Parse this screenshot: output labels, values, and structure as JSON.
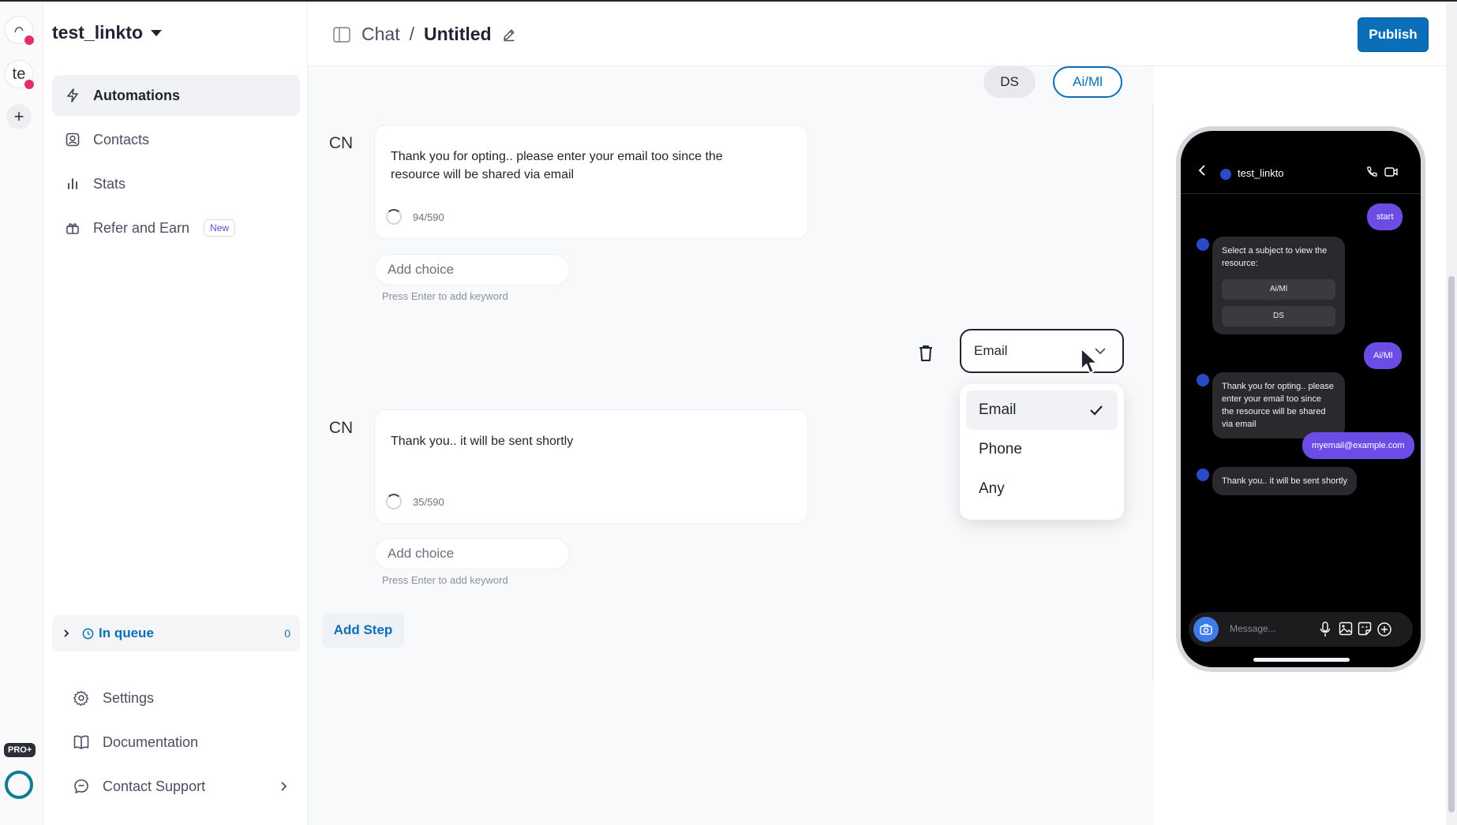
{
  "workspace": {
    "name": "test_linkto"
  },
  "rail": {
    "account2_initials": "te",
    "pro_label": "PRO+"
  },
  "sidebar": {
    "items": [
      {
        "label": "Automations"
      },
      {
        "label": "Contacts"
      },
      {
        "label": "Stats"
      },
      {
        "label": "Refer and Earn",
        "badge": "New"
      }
    ],
    "queue": {
      "label": "In queue",
      "count": "0"
    },
    "footer": [
      {
        "label": "Settings"
      },
      {
        "label": "Documentation"
      },
      {
        "label": "Contact Support"
      }
    ]
  },
  "header": {
    "section": "Chat",
    "separator": "/",
    "title": "Untitled",
    "publish_label": "Publish"
  },
  "flow": {
    "reply_options": [
      "DS",
      "Ai/Ml"
    ],
    "steps": [
      {
        "sender": "CN",
        "text": "Thank you for opting.. please enter your email too since the resource will be shared via email",
        "counter": "94/590",
        "choice_placeholder": "Add choice",
        "hint": "Press Enter to add keyword"
      },
      {
        "sender": "CN",
        "text": "Thank you.. it will be sent shortly",
        "counter": "35/590",
        "choice_placeholder": "Add choice",
        "hint": "Press Enter to add keyword"
      }
    ],
    "add_step_label": "Add Step",
    "input_type": {
      "selected": "Email",
      "options": [
        "Email",
        "Phone",
        "Any"
      ]
    }
  },
  "preview": {
    "contact_name": "test_linkto",
    "messages": {
      "out1": "start",
      "in1": "Select a subject to view the resource:",
      "in1_buttons": [
        "Ai/Ml",
        "DS"
      ],
      "out2": "Ai/Ml",
      "in2": "Thank you for opting.. please enter your email too since the resource will be shared via email",
      "out3": "myemail@example.com",
      "in3": "Thank you.. it will be sent shortly"
    },
    "input_placeholder": "Message..."
  },
  "colors": {
    "accent": "#0a6fb8",
    "user_bubble": "#6b4de6",
    "bot_bubble": "#2a2a2e"
  }
}
